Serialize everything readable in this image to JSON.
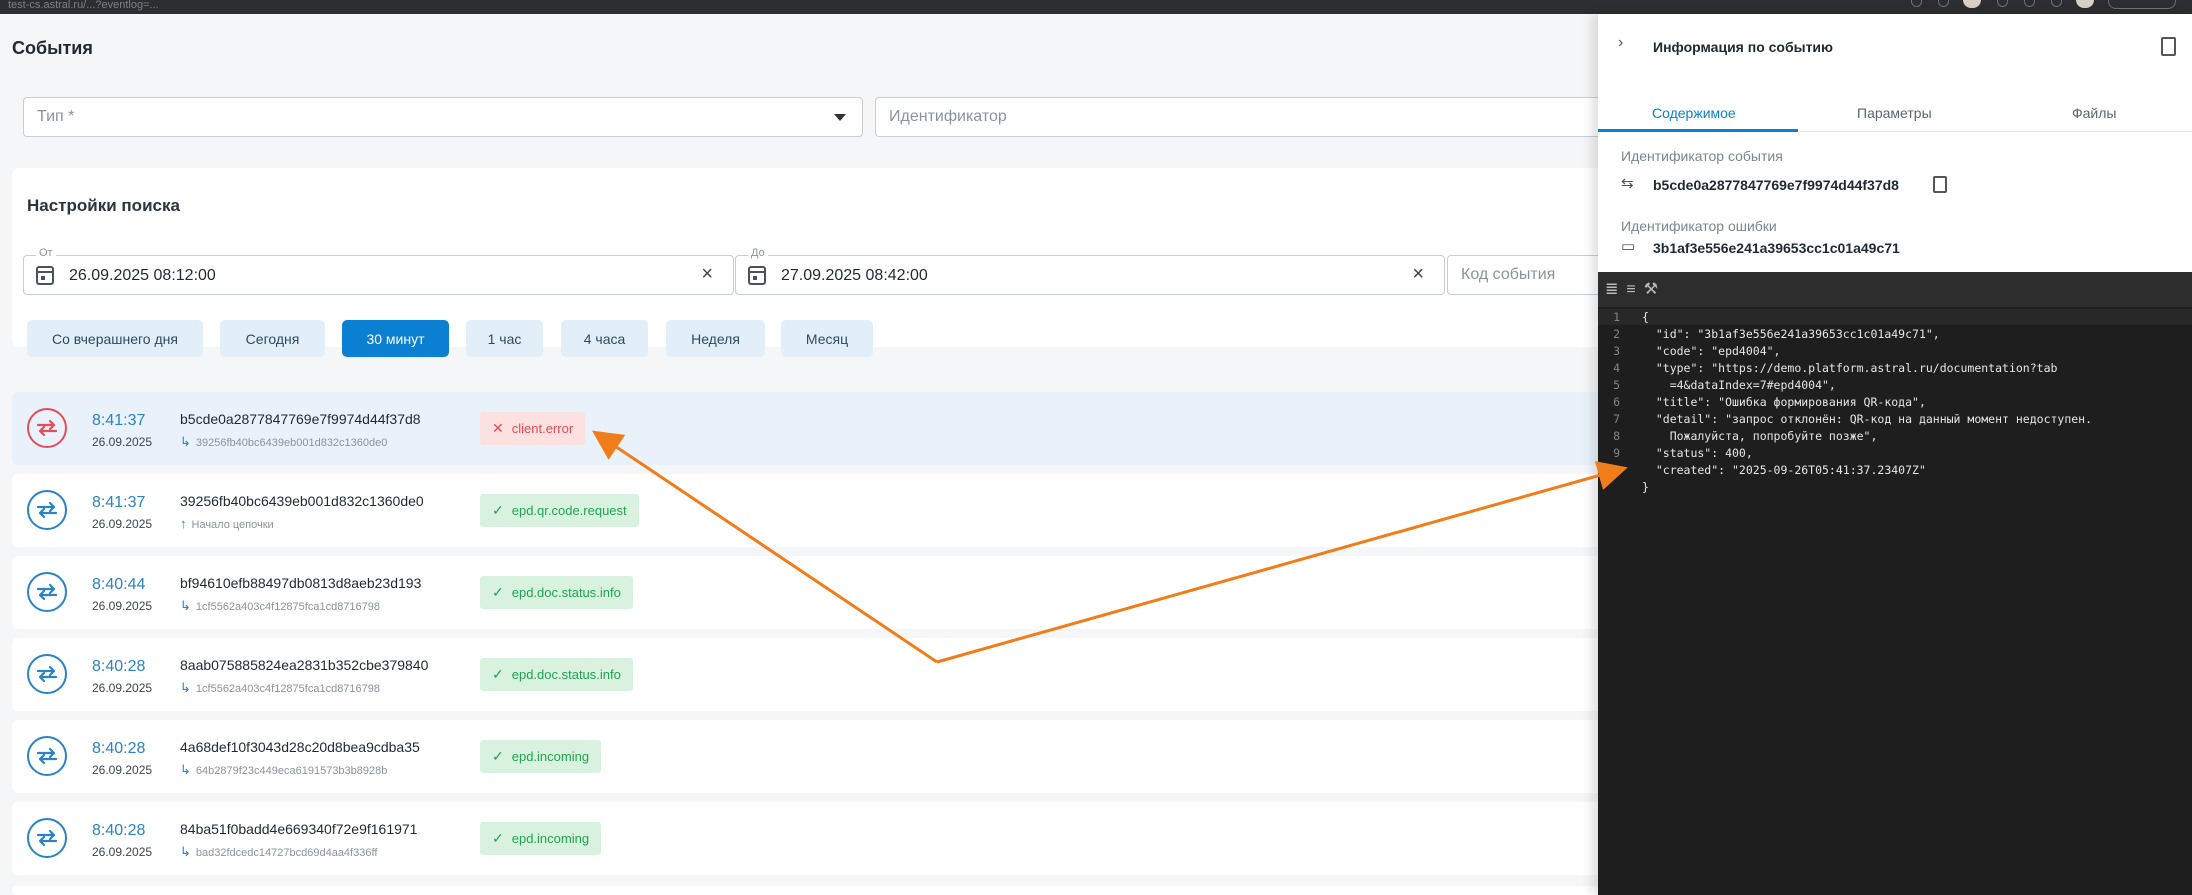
{
  "browser": {
    "url": "test-cs.astral.ru/...?eventlog=..."
  },
  "page": {
    "title": "События"
  },
  "filters": {
    "type_placeholder": "Тип *",
    "id_placeholder": "Идентификатор"
  },
  "search": {
    "title": "Настройки поиска",
    "from_label": "От",
    "from_value": "26.09.2025 08:12:00",
    "to_label": "До",
    "to_value": "27.09.2025 08:42:00",
    "code_placeholder": "Код события",
    "chips": [
      "Со вчерашнего дня",
      "Сегодня",
      "30 минут",
      "1 час",
      "4 часа",
      "Неделя",
      "Месяц"
    ],
    "active_chip": "30 минут"
  },
  "events": [
    {
      "time": "8:41:37",
      "date": "26.09.2025",
      "id": "b5cde0a2877847769e7f9974d44f37d8",
      "sub": "39256fb40bc6439eb001d832c1360de0",
      "badge": "client.error",
      "status": "error",
      "selected": true
    },
    {
      "time": "8:41:37",
      "date": "26.09.2025",
      "id": "39256fb40bc6439eb001d832c1360de0",
      "sub": "Начало цепочки",
      "badge": "epd.qr.code.request",
      "status": "ok",
      "selected": false
    },
    {
      "time": "8:40:44",
      "date": "26.09.2025",
      "id": "bf94610efb88497db0813d8aeb23d193",
      "sub": "1cf5562a403c4f12875fca1cd8716798",
      "badge": "epd.doc.status.info",
      "status": "ok",
      "selected": false
    },
    {
      "time": "8:40:28",
      "date": "26.09.2025",
      "id": "8aab075885824ea2831b352cbe379840",
      "sub": "1cf5562a403c4f12875fca1cd8716798",
      "badge": "epd.doc.status.info",
      "status": "ok",
      "selected": false
    },
    {
      "time": "8:40:28",
      "date": "26.09.2025",
      "id": "4a68def10f3043d28c20d8bea9cdba35",
      "sub": "64b2879f23c449eca6191573b3b8928b",
      "badge": "epd.incoming",
      "status": "ok",
      "selected": false
    },
    {
      "time": "8:40:28",
      "date": "26.09.2025",
      "id": "84ba51f0badd4e669340f72e9f161971",
      "sub": "bad32fdcedc14727bcd69d4aa4f336ff",
      "badge": "epd.incoming",
      "status": "ok",
      "selected": false
    }
  ],
  "panel": {
    "title": "Информация по событию",
    "tabs": [
      "Содержимое",
      "Параметры",
      "Файлы"
    ],
    "active_tab": "Содержимое",
    "event_id_label": "Идентификатор события",
    "event_id": "b5cde0a2877847769e7f9974d44f37d8",
    "error_id_label": "Идентификатор ошибки",
    "error_id": "3b1af3e556e241a39653cc1c01a49c71",
    "code_lines": [
      "{",
      "  \"id\": \"3b1af3e556e241a39653cc1c01a49c71\",",
      "  \"code\": \"epd4004\",",
      "  \"type\": \"https://demo.platform.astral.ru/documentation?tab",
      "    =4&dataIndex=7#epd4004\",",
      "  \"title\": \"Ошибка формирования QR-кода\",",
      "  \"detail\": \"запрос отклонён: QR-код на данный момент недоступен.",
      "    Пожалуйста, попробуйте позже\",",
      "  \"status\": 400,",
      "  \"created\": \"2025-09-26T05:41:37.23407Z\"",
      "}"
    ],
    "line_numbers": [
      "1",
      "2",
      "3",
      "4",
      "",
      "5",
      "6",
      "",
      "7",
      "8",
      "9"
    ]
  },
  "annotation": {
    "color": "#f07c1a"
  }
}
